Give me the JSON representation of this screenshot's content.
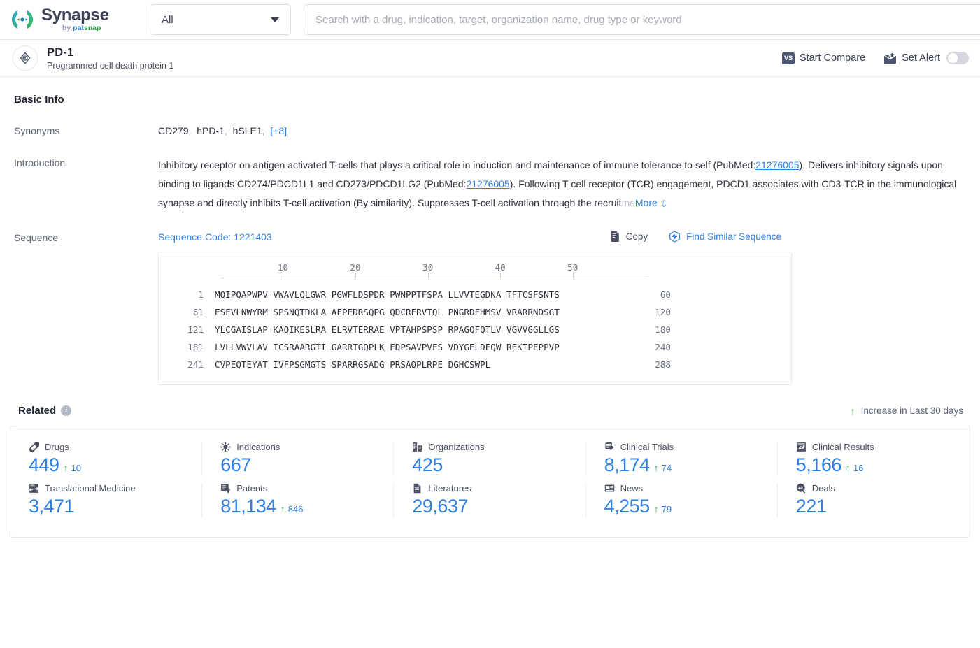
{
  "brand": {
    "name": "Synapse",
    "by": "by ",
    "company_pat": "pat",
    "company_snap": "snap",
    "logo_icon": "synapse-logo-icon"
  },
  "search": {
    "scope_value": "All",
    "scope_caret_icon": "chevron-down-icon",
    "placeholder": "Search with a drug, indication, target, organization name, drug type or keyword",
    "input_value": ""
  },
  "entity": {
    "icon": "target-icon",
    "name": "PD-1",
    "description": "Programmed cell death protein 1",
    "actions": {
      "compare_label": "Start Compare",
      "compare_icon": "vs-icon",
      "compare_badge_text": "VS",
      "alert_label": "Set Alert",
      "alert_icon": "alert-mail-icon",
      "alert_toggle_on": false
    }
  },
  "basic_info": {
    "title": "Basic Info",
    "synonyms": {
      "label": "Synonyms",
      "items": [
        "CD279",
        "hPD-1",
        "hSLE1"
      ],
      "more_label": "[+8]"
    },
    "introduction": {
      "label": "Introduction",
      "text_1": "Inhibitory receptor on antigen activated T-cells that plays a critical role in induction and maintenance of immune tolerance to self (PubMed:",
      "link_1": "21276005",
      "text_2": "). Delivers inhibitory signals upon binding to ligands CD274/PDCD1L1 and CD273/PDCD1LG2 (PubMed:",
      "link_2": "21276005",
      "text_3": "). Following T-cell receptor (TCR) engagement, PDCD1 associates with CD3-TCR in the immunological synapse and directly inhibits T-cell activation (By similarity). Suppresses T-cell activation through the recruit",
      "text_fade": "me",
      "more_label": "More",
      "more_icon": "chevron-double-down-icon"
    },
    "sequence": {
      "label": "Sequence",
      "code_label": "Sequence Code: 1221403",
      "copy_label": "Copy",
      "copy_icon": "copy-icon",
      "find_label": "Find Similar Sequence",
      "find_icon": "find-similar-icon",
      "ruler_ticks": [
        10,
        20,
        30,
        40,
        50
      ],
      "rows": [
        {
          "start": "1",
          "letters": "MQIPQAPWPV VWAVLQLGWR PGWFLDSPDR PWNPPTFSPA LLVVTEGDNA TFTCSFSNTS",
          "end": "60"
        },
        {
          "start": "61",
          "letters": "ESFVLNWYRM SPSNQTDKLA AFPEDRSQPG QDCRFRVTQL PNGRDFHMSV VRARRNDSGT",
          "end": "120"
        },
        {
          "start": "121",
          "letters": "YLCGAISLAP KAQIKESLRA ELRVTERRAE VPTAHPSPSP RPAGQFQTLV VGVVGGLLGS",
          "end": "180"
        },
        {
          "start": "181",
          "letters": "LVLLVWVLAV ICSRAARGTI GARRTGQPLK EDPSAVPVFS VDYGELDFQW REKTPEPPVP",
          "end": "240"
        },
        {
          "start": "241",
          "letters": "CVPEQTEYAT IVFPSGMGTS SPARRGSADG PRSAQPLRPE DGHCSWPL",
          "end": "288"
        }
      ]
    }
  },
  "related": {
    "title": "Related",
    "info_icon": "info-icon",
    "legend": "Increase in Last 30 days",
    "legend_icon": "arrow-up-icon",
    "stats": [
      {
        "label": "Drugs",
        "icon": "pill-icon",
        "value": "449",
        "delta": "10"
      },
      {
        "label": "Indications",
        "icon": "virus-icon",
        "value": "667",
        "delta": ""
      },
      {
        "label": "Organizations",
        "icon": "organization-icon",
        "value": "425",
        "delta": ""
      },
      {
        "label": "Clinical Trials",
        "icon": "clinical-trial-icon",
        "value": "8,174",
        "delta": "74"
      },
      {
        "label": "Clinical Results",
        "icon": "clinical-result-icon",
        "value": "5,166",
        "delta": "16"
      },
      {
        "label": "Translational Medicine",
        "icon": "translational-icon",
        "value": "3,471",
        "delta": ""
      },
      {
        "label": "Patents",
        "icon": "patent-icon",
        "value": "81,134",
        "delta": "846"
      },
      {
        "label": "Literatures",
        "icon": "literature-icon",
        "value": "29,637",
        "delta": ""
      },
      {
        "label": "News",
        "icon": "news-icon",
        "value": "4,255",
        "delta": "79"
      },
      {
        "label": "Deals",
        "icon": "deal-icon",
        "value": "221",
        "delta": ""
      }
    ]
  },
  "colors": {
    "accent_blue": "#2f7fe0",
    "increase_green": "#28a745",
    "text_dark": "#2b2f3a",
    "label_gray": "#5d6476"
  }
}
